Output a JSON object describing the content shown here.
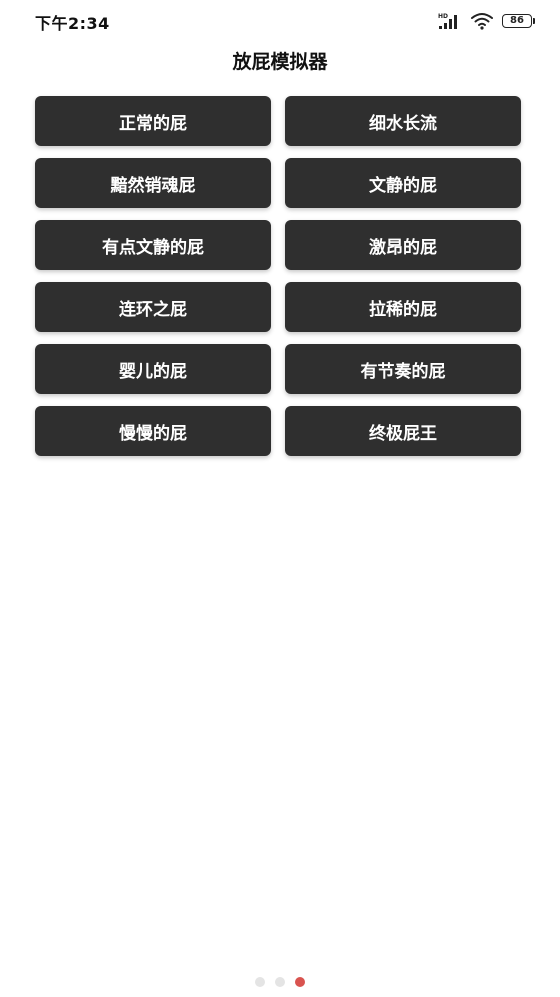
{
  "status_bar": {
    "time": "下午2:34",
    "battery": "86",
    "network_label": "HD",
    "icons": [
      "signal-icon",
      "wifi-icon",
      "battery-icon"
    ]
  },
  "header": {
    "title": "放屁模拟器"
  },
  "buttons": [
    "正常的屁",
    "细水长流",
    "黯然销魂屁",
    "文静的屁",
    "有点文静的屁",
    "激昂的屁",
    "连环之屁",
    "拉稀的屁",
    "婴儿的屁",
    "有节奏的屁",
    "慢慢的屁",
    "终极屁王"
  ],
  "pager": {
    "page_count": 3,
    "current_page": 3
  },
  "colors": {
    "button_bg": "#2f2f2f",
    "button_text": "#ffffff",
    "dot_inactive": "#e4e4e4",
    "dot_active": "#d9534f"
  }
}
